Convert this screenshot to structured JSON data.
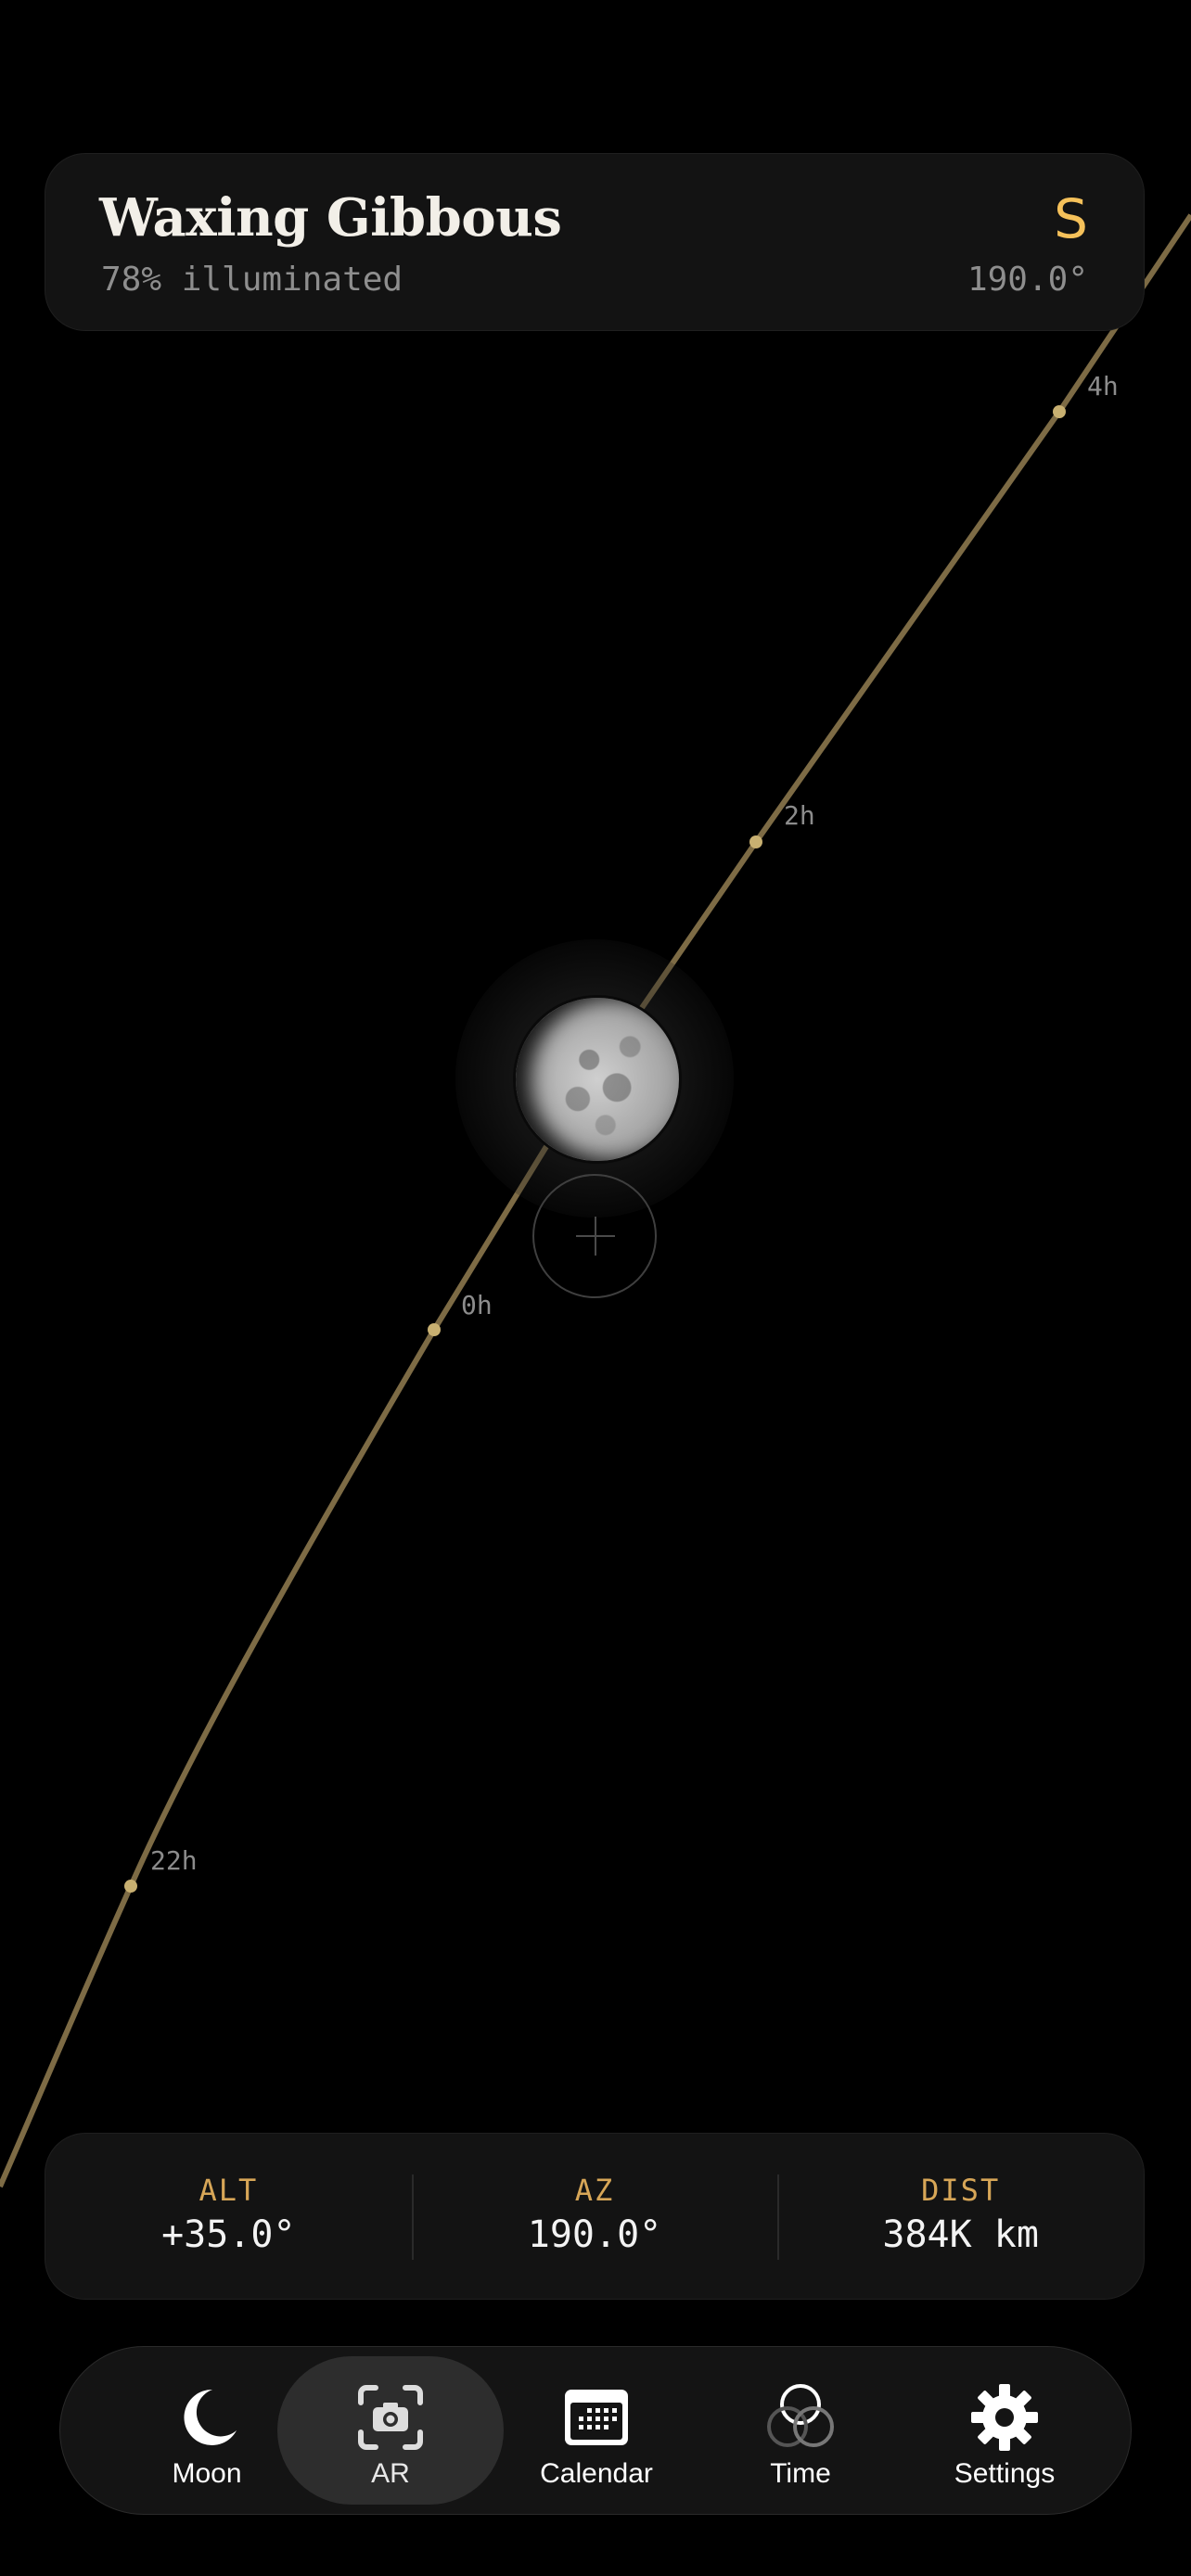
{
  "header": {
    "phase": "Waxing Gibbous",
    "illumination": "78% illuminated",
    "direction": "S",
    "azimuth": "190.0°"
  },
  "path_labels": [
    "4h",
    "2h",
    "0h",
    "22h"
  ],
  "stats": [
    {
      "label": "ALT",
      "value": "+35.0°"
    },
    {
      "label": "AZ",
      "value": "190.0°"
    },
    {
      "label": "DIST",
      "value": "384K km"
    }
  ],
  "tabs": [
    {
      "label": "Moon",
      "icon": "moon-icon",
      "active": false
    },
    {
      "label": "AR",
      "icon": "camera-icon",
      "active": true
    },
    {
      "label": "Calendar",
      "icon": "calendar-icon",
      "active": false
    },
    {
      "label": "Time",
      "icon": "time-icon",
      "active": false
    },
    {
      "label": "Settings",
      "icon": "gear-icon",
      "active": false
    }
  ],
  "colors": {
    "accent": "#f5c15a",
    "label_accent": "#d7a657",
    "path": "#7d6b45",
    "path_dot": "#c8b071"
  }
}
